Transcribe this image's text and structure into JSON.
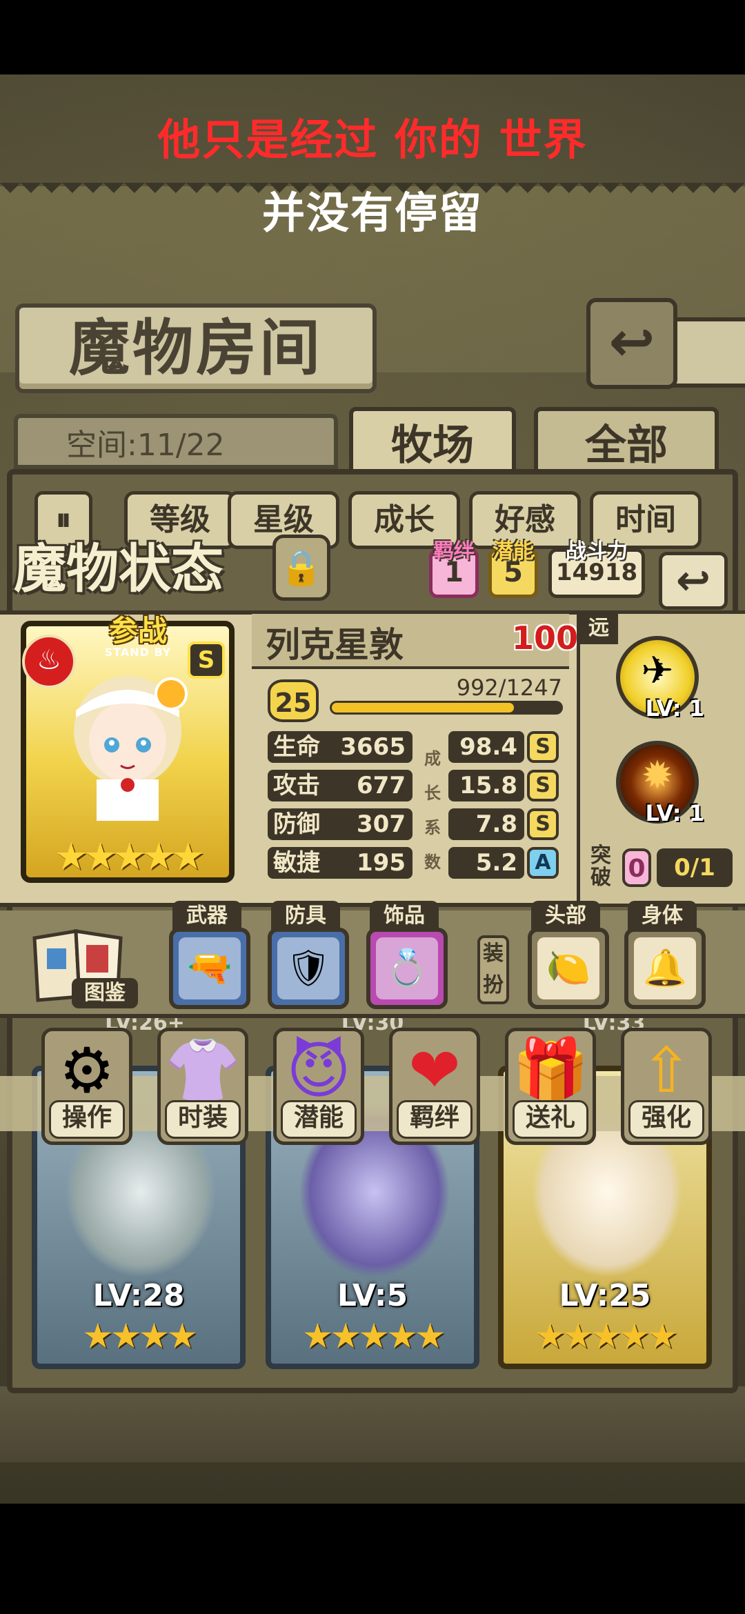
{
  "lyrics": {
    "line1": "他只是经过 你的 世界",
    "line2": "并没有停留"
  },
  "header": {
    "title": "魔物房间",
    "back_icon": "return-arrow-icon"
  },
  "room": {
    "space_label": "空间:11/22",
    "tabs": [
      {
        "label": "牧场",
        "active": true
      },
      {
        "label": "全部",
        "active": false
      }
    ],
    "sort_toggle_icon": "sort-toggle-icon",
    "sort_buttons": [
      "等级",
      "星级",
      "成长",
      "好感",
      "时间"
    ]
  },
  "status": {
    "title": "魔物状态",
    "lock_icon": "padlock-icon",
    "bond": {
      "label": "羁绊",
      "value": "1"
    },
    "potential": {
      "label": "潜能",
      "value": "5"
    },
    "power": {
      "label": "战斗力",
      "value": "14918"
    },
    "return_icon": "return-arrow-icon",
    "monster": {
      "name": "列克星敦",
      "affection": "100",
      "standby": "参战",
      "standby_sub": "STAND BY",
      "rank": "S",
      "element_icon": "fire-icon",
      "level": "25",
      "exp": "992/1247",
      "exp_fraction": 0.7955,
      "stars": "★★★★★"
    },
    "stats": [
      {
        "key": "生命",
        "value": "3665",
        "growth": "98.4",
        "grade": "S"
      },
      {
        "key": "攻击",
        "value": "677",
        "growth": "15.8",
        "grade": "S"
      },
      {
        "key": "防御",
        "value": "307",
        "growth": "7.8",
        "grade": "S"
      },
      {
        "key": "敏捷",
        "value": "195",
        "growth": "5.2",
        "grade": "A"
      }
    ],
    "growth_vertical_label": [
      "成",
      "长",
      "系",
      "数"
    ],
    "range_tag": "远",
    "skills": [
      {
        "icon": "aircraft-squadron-icon",
        "lv": "LV: 1"
      },
      {
        "icon": "explosion-burst-icon",
        "lv": "LV: 1"
      }
    ],
    "breakthrough": {
      "label": "突破",
      "value": "0",
      "ratio": "0/1"
    }
  },
  "equipment": {
    "book_label": "图鉴",
    "slots": [
      {
        "label": "武器",
        "icon": "gatling-gun-icon"
      },
      {
        "label": "防具",
        "icon": "shield-emblem-icon"
      },
      {
        "label": "饰品",
        "icon": "ring-icon"
      }
    ],
    "dress_label": "装扮",
    "costume_slots": [
      {
        "label": "头部",
        "icon": "straw-lemon-icon"
      },
      {
        "label": "身体",
        "icon": "bell-collar-icon"
      }
    ]
  },
  "actions": [
    {
      "label": "操作",
      "icon": "gear-icon"
    },
    {
      "label": "时装",
      "icon": "dress-icon"
    },
    {
      "label": "潜能",
      "icon": "demon-icon"
    },
    {
      "label": "羁绊",
      "icon": "hearts-icon"
    },
    {
      "label": "送礼",
      "icon": "gift-icon"
    },
    {
      "label": "强化",
      "icon": "upgrade-arrows-icon"
    }
  ],
  "monster_list": [
    {
      "lv": "LV:28",
      "stars": "★★★★"
    },
    {
      "lv": "LV:5",
      "stars": "★★★★★"
    },
    {
      "lv": "LV:25",
      "stars": "★★★★★"
    }
  ],
  "peek_levels": [
    "LV:26+",
    "LV:30",
    "LV:33"
  ]
}
